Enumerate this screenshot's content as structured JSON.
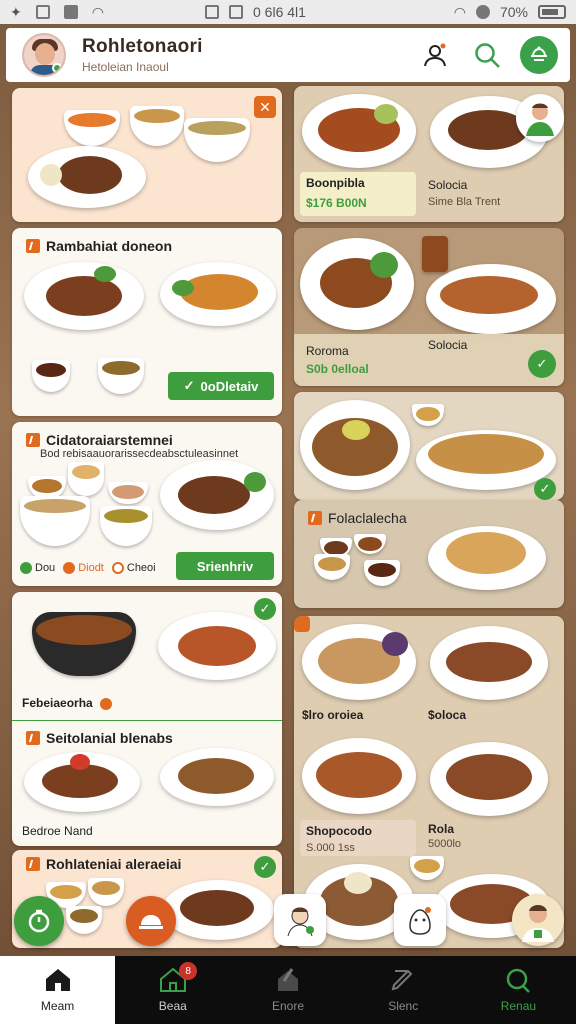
{
  "status_bar": {
    "center_text": "0 6l6 4l1",
    "battery": "70%"
  },
  "header": {
    "title": "Rohletonaori",
    "subtitle": "Hetoleian Inaoul",
    "icons": [
      "profile-icon",
      "search-icon",
      "restaurant-icon"
    ]
  },
  "left_cards": [
    {
      "title": "",
      "close_symbol": "✕"
    },
    {
      "title": "Rambahiat doneon",
      "button_label": "0oDletaiv"
    },
    {
      "title": "Cidatoraiarstemnei",
      "subtitle": "Bod rebisaauorarissecdeabsctuleasinnet",
      "tags": [
        "Dou",
        "Diodt",
        "Cheoi"
      ],
      "button_label": "Srienhriv"
    },
    {
      "title": "",
      "label": "Febeiaeorha"
    },
    {
      "title": "Seitolanial blenabs",
      "label": "Bedroe Nand"
    },
    {
      "title": "Rohlateniai aleraeiai"
    }
  ],
  "right_cards": [
    {
      "item1_name": "Boonpibla",
      "item1_price": "$176 B00N",
      "item2_name": "Solocia",
      "item2_price": "Sime Bla Trent"
    },
    {
      "item1_name": "Roroma",
      "item1_price": "S0b 0elloal",
      "item2_name": "Solocia"
    },
    {
      "title": ""
    },
    {
      "title": "Folaclalecha"
    },
    {
      "item1_name": "$lro oroiea",
      "item2_name": "$oloca",
      "item3_name": "Shopocodo",
      "item3_price": "S.000 1ss",
      "item4_name": "Rola",
      "item4_price": "5000lo"
    }
  ],
  "bottom_nav": [
    {
      "label": "Meam",
      "icon": "home-icon",
      "active": true
    },
    {
      "label": "Beaa",
      "icon": "store-icon",
      "badge": "8"
    },
    {
      "label": "Enore",
      "icon": "explore-icon"
    },
    {
      "label": "Slenc",
      "icon": "edit-icon"
    },
    {
      "label": "Renau",
      "icon": "search-icon"
    }
  ],
  "colors": {
    "accent_green": "#3e9e3e",
    "accent_orange": "#e06b1f",
    "nav_bg": "#0d0d0d"
  }
}
